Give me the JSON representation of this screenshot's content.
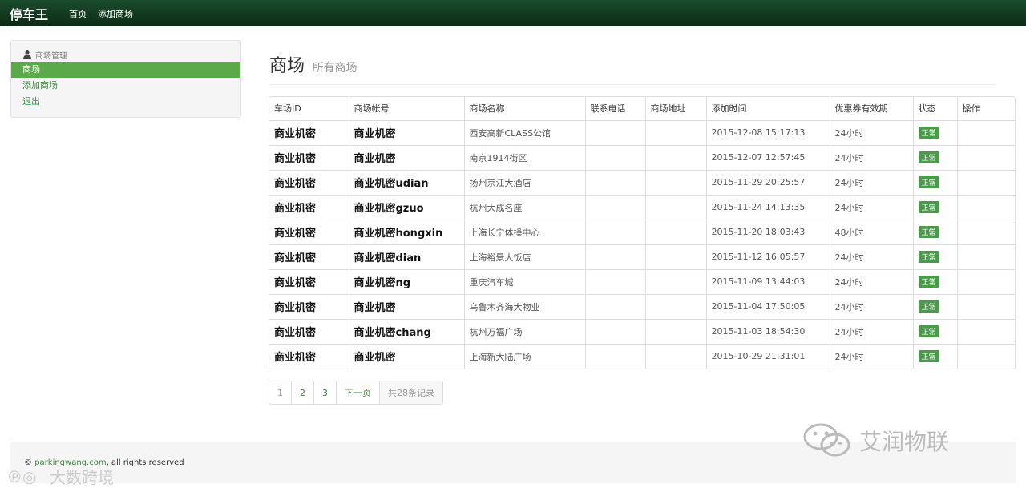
{
  "navbar": {
    "brand": "停车王",
    "links": [
      "首页",
      "添加商场"
    ]
  },
  "sidebar": {
    "header": "商场管理",
    "items": [
      "商场",
      "添加商场",
      "退出"
    ]
  },
  "header": {
    "title": "商场",
    "subtitle": "所有商场"
  },
  "table": {
    "columns": [
      "车场ID",
      "商场帐号",
      "商场名称",
      "联系电话",
      "商场地址",
      "添加时间",
      "优惠券有效期",
      "状态",
      "操作"
    ],
    "rows": [
      {
        "id": "商业机密",
        "account": "商业机密",
        "name": "西安高新CLASS公馆",
        "phone": "",
        "address": "",
        "time": "2015-12-08 15:17:13",
        "validity": "24小时",
        "status": "正常",
        "action": ""
      },
      {
        "id": "商业机密",
        "account": "商业机密",
        "name": "南京1914街区",
        "phone": "",
        "address": "",
        "time": "2015-12-07 12:57:45",
        "validity": "24小时",
        "status": "正常",
        "action": ""
      },
      {
        "id": "商业机密",
        "account": "商业机密udian",
        "name": "扬州京江大酒店",
        "phone": "",
        "address": "",
        "time": "2015-11-29 20:25:57",
        "validity": "24小时",
        "status": "正常",
        "action": ""
      },
      {
        "id": "商业机密",
        "account": "商业机密gzuo",
        "name": "杭州大成名座",
        "phone": "",
        "address": "",
        "time": "2015-11-24 14:13:35",
        "validity": "24小时",
        "status": "正常",
        "action": ""
      },
      {
        "id": "商业机密",
        "account": "商业机密hongxin",
        "name": "上海长宁体操中心",
        "phone": "",
        "address": "",
        "time": "2015-11-20 18:03:43",
        "validity": "48小时",
        "status": "正常",
        "action": ""
      },
      {
        "id": "商业机密",
        "account": "商业机密dian",
        "name": "上海裕景大饭店",
        "phone": "",
        "address": "",
        "time": "2015-11-12 16:05:57",
        "validity": "24小时",
        "status": "正常",
        "action": ""
      },
      {
        "id": "商业机密",
        "account": "商业机密ng",
        "name": "重庆汽车城",
        "phone": "",
        "address": "",
        "time": "2015-11-09 13:44:03",
        "validity": "24小时",
        "status": "正常",
        "action": ""
      },
      {
        "id": "商业机密",
        "account": "商业机密",
        "name": "乌鲁木齐海大物业",
        "phone": "",
        "address": "",
        "time": "2015-11-04 17:50:05",
        "validity": "24小时",
        "status": "正常",
        "action": ""
      },
      {
        "id": "商业机密",
        "account": "商业机密chang",
        "name": "杭州万福广场",
        "phone": "",
        "address": "",
        "time": "2015-11-03 18:54:30",
        "validity": "24小时",
        "status": "正常",
        "action": ""
      },
      {
        "id": "商业机密",
        "account": "商业机密",
        "name": "上海新大陆广场",
        "phone": "",
        "address": "",
        "time": "2015-10-29 21:31:01",
        "validity": "24小时",
        "status": "正常",
        "action": ""
      }
    ]
  },
  "pagination": {
    "pages": [
      "1",
      "2",
      "3"
    ],
    "next": "下一页",
    "total": "共28条记录"
  },
  "footer": {
    "copy": "©",
    "link": "parkingwang.com",
    "rest": ", all rights reserved"
  },
  "watermarks": {
    "right": "艾润物联",
    "left": "大数跨境"
  },
  "colors": {
    "navbar": "#1b4d2c",
    "accent": "#5aaa4a",
    "link": "#3a8a3a",
    "badge": "#4b9a4b"
  }
}
